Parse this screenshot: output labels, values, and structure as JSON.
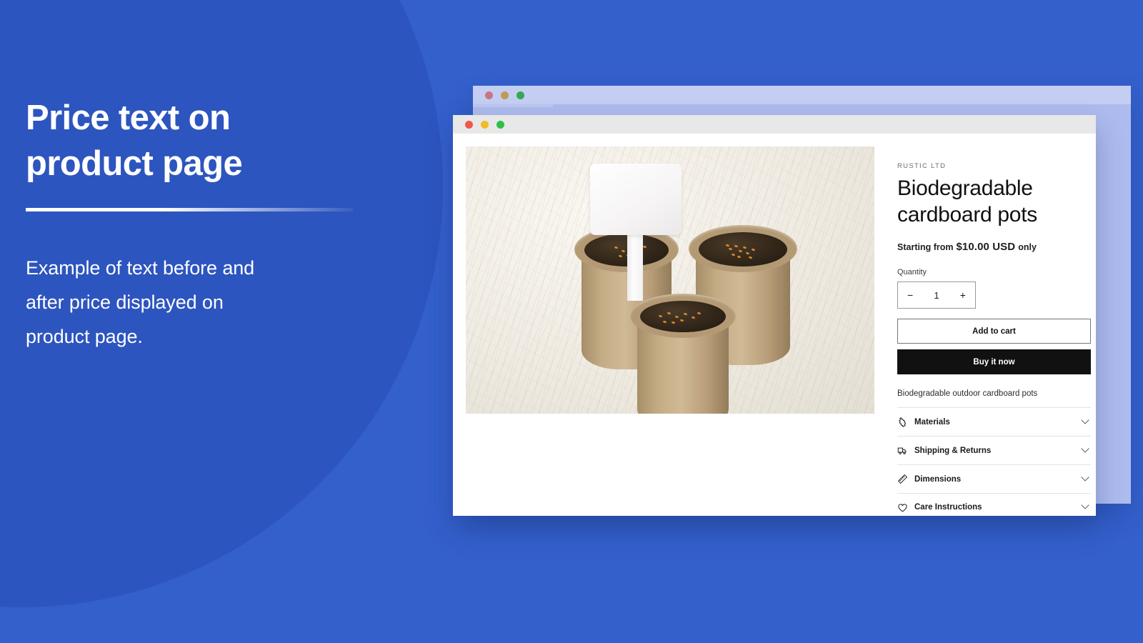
{
  "background": {
    "base_color": "#3460cc",
    "circle_color": "#2d55bf"
  },
  "promo": {
    "heading": "Price text on\nproduct page",
    "body": "Example of text before and\nafter price displayed on\nproduct page."
  },
  "windows": {
    "back": {
      "traffic_lights": [
        "red",
        "yellow",
        "green"
      ],
      "dot_colors": [
        "#cc7487",
        "#c09a54",
        "#34a853"
      ],
      "titlebar_color": "#c3cef2"
    },
    "front": {
      "traffic_lights": [
        "red",
        "yellow",
        "green"
      ],
      "dot_colors": [
        "#f2564c",
        "#f5bb22",
        "#2ec14a"
      ],
      "titlebar_color": "#e8e8e8"
    }
  },
  "product": {
    "vendor": "RUSTIC LTD",
    "title": "Biodegradable cardboard pots",
    "price": {
      "prefix": "Starting from",
      "value": "$10.00 USD",
      "suffix": "only"
    },
    "quantity": {
      "label": "Quantity",
      "decrement": "−",
      "value": "1",
      "increment": "+"
    },
    "buttons": {
      "add_to_cart": "Add to cart",
      "buy_it_now": "Buy it now"
    },
    "description": "Biodegradable outdoor cardboard pots",
    "accordion": [
      {
        "label": "Materials",
        "icon": "leather-hide-icon"
      },
      {
        "label": "Shipping & Returns",
        "icon": "truck-icon"
      },
      {
        "label": "Dimensions",
        "icon": "ruler-icon"
      },
      {
        "label": "Care Instructions",
        "icon": "heart-icon"
      }
    ],
    "image_alt": "Three biodegradable cardboard seedling pots filled with dark soil and orange seeds, with a blank white plant label stake"
  }
}
